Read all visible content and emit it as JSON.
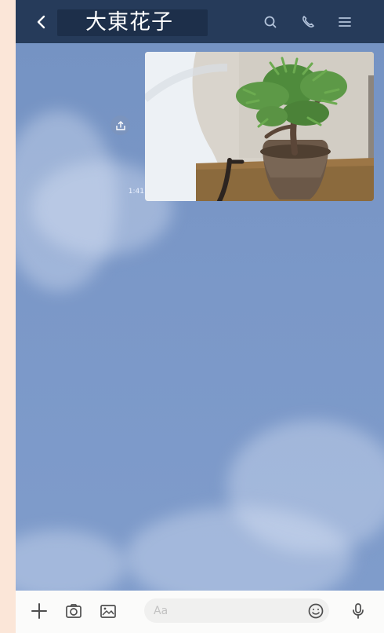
{
  "header": {
    "title": "大東花子"
  },
  "chat": {
    "messages": [
      {
        "type": "image",
        "subject": "bonsai-pine-tree-photo",
        "timestamp": "1:41"
      }
    ]
  },
  "input": {
    "placeholder": "Aa"
  },
  "icons": {
    "back": "chevron-left-icon",
    "search": "search-icon",
    "call": "phone-icon",
    "menu": "menu-icon",
    "share": "share-icon",
    "plus": "plus-icon",
    "camera": "camera-icon",
    "image": "image-icon",
    "emoji": "emoji-icon",
    "mic": "microphone-icon"
  },
  "colors": {
    "header_bg": "#263b5a",
    "chat_bg": "#7b98c8",
    "input_bar_bg": "#fbfbfa",
    "page_bg": "#fbe6d8"
  }
}
